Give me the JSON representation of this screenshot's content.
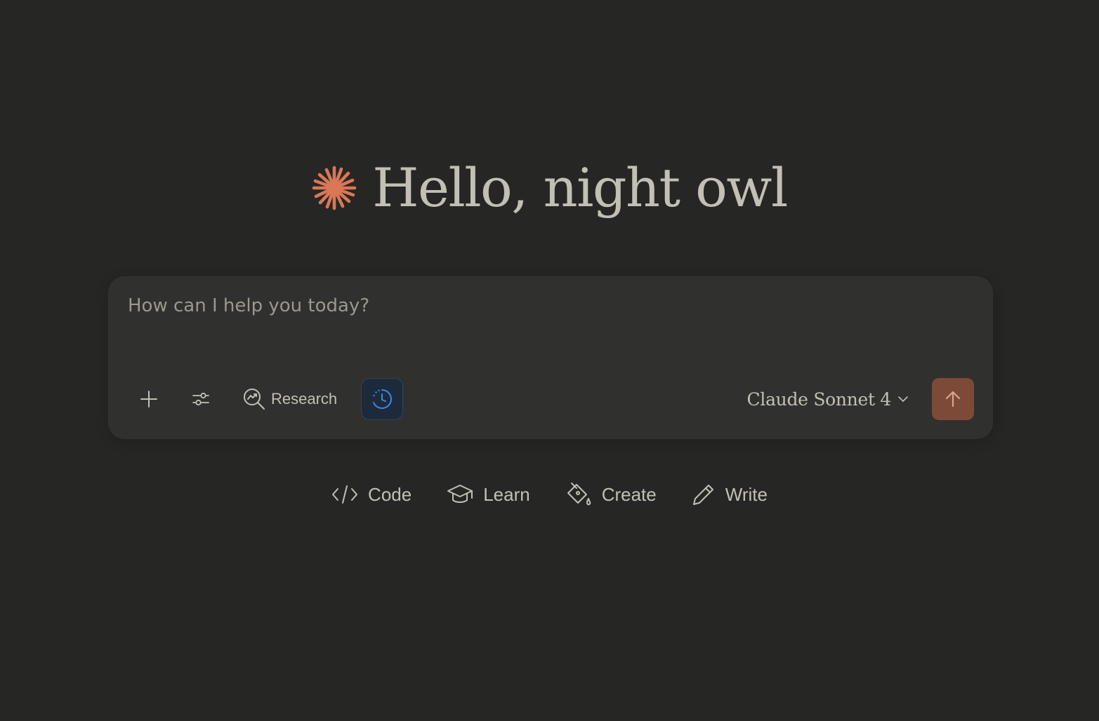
{
  "greeting": {
    "text": "Hello, night owl"
  },
  "composer": {
    "placeholder": "How can I help you today?",
    "research_label": "Research",
    "model_label": "Claude Sonnet 4"
  },
  "quick_actions": {
    "code": "Code",
    "learn": "Learn",
    "create": "Create",
    "write": "Write"
  },
  "icons": {
    "logo": "claude-spark-icon",
    "add": "plus-icon",
    "tools": "sliders-icon",
    "research": "search-chart-icon",
    "extended_thinking": "clock-icon",
    "model_dropdown": "chevron-down-icon",
    "send": "arrow-up-icon",
    "code": "code-icon",
    "learn": "graduation-cap-icon",
    "create": "paint-bucket-icon",
    "write": "pencil-icon"
  },
  "colors": {
    "background": "#262624",
    "composer": "#30302e",
    "accent": "#d97757",
    "send_button": "#7c4a36",
    "active_tool": "#3b8be0",
    "text": "#c2c0b6",
    "placeholder": "#9a988f"
  }
}
